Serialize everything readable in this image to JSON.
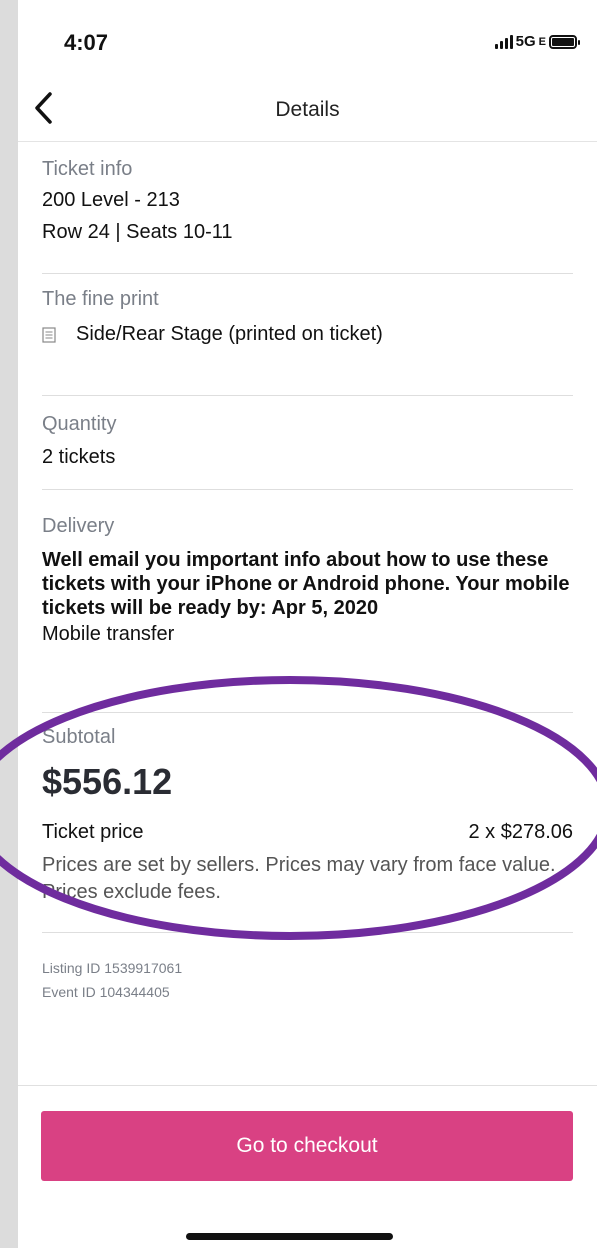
{
  "status": {
    "time": "4:07",
    "network": "5G",
    "network_suffix": "E"
  },
  "nav": {
    "title": "Details"
  },
  "ticket_info": {
    "label": "Ticket info",
    "section": "200 Level - 213",
    "seats": "Row 24 | Seats 10-11"
  },
  "fine_print": {
    "label": "The fine print",
    "item": "Side/Rear Stage (printed on ticket)"
  },
  "quantity": {
    "label": "Quantity",
    "value": "2 tickets"
  },
  "delivery": {
    "label": "Delivery",
    "description": "Well email you important info about how to use these tickets with your iPhone or Android phone. Your mobile tickets will be ready by: Apr 5, 2020",
    "method": "Mobile transfer"
  },
  "subtotal": {
    "label": "Subtotal",
    "amount": "$556.12",
    "ticket_price_label": "Ticket price",
    "ticket_price_value": "2 x $278.06",
    "note": "Prices are set by sellers. Prices may vary from face value. Prices exclude fees."
  },
  "meta": {
    "listing_id": "Listing ID 1539917061",
    "event_id": "Event ID 104344405"
  },
  "checkout": {
    "label": "Go to checkout"
  },
  "colors": {
    "accent": "#d94183",
    "annotation": "#6f2c9e"
  }
}
